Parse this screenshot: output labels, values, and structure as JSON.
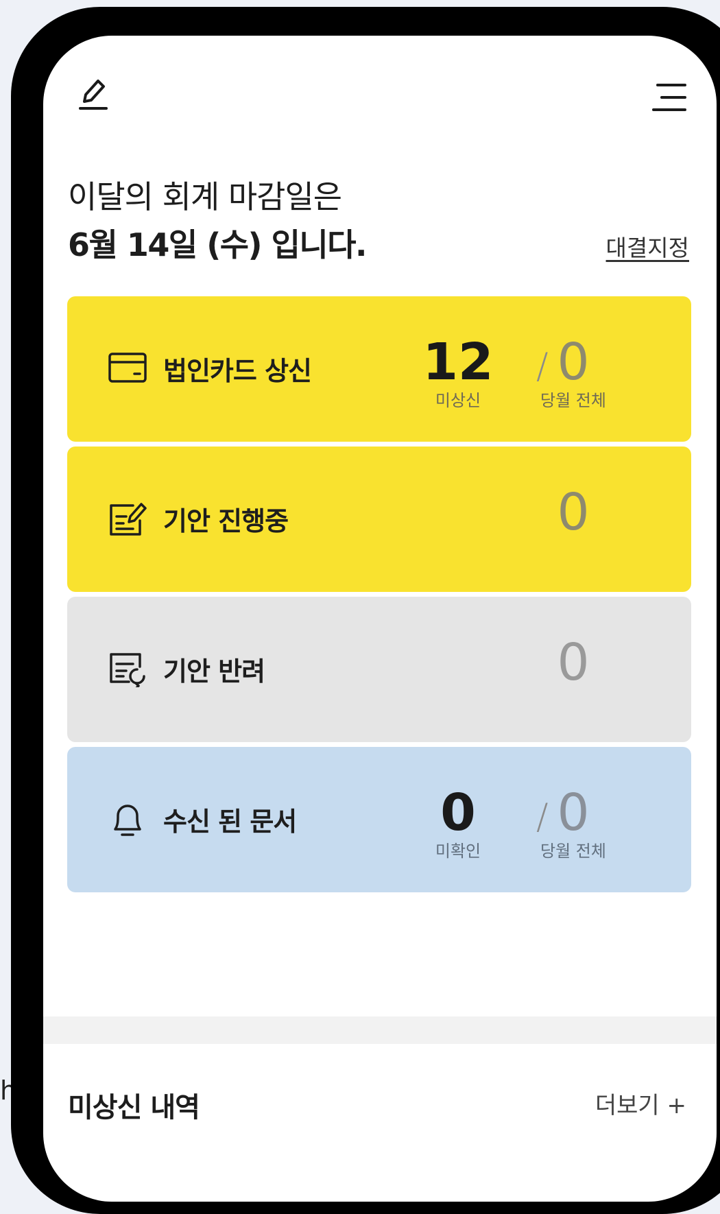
{
  "edge_text": "h",
  "header": {
    "icons": [
      "pencil-icon",
      "menu-icon"
    ]
  },
  "headline": {
    "line1": "이달의 회계 마감일은",
    "line2": "6월 14일 (수) 입니다."
  },
  "proxy_link": "대결지정",
  "cards": {
    "corporate_card": {
      "title": "법인카드 상신",
      "icon": "credit-card-icon",
      "stat_primary": {
        "value": "12",
        "caption": "미상신"
      },
      "stat_secondary": {
        "value": "0",
        "caption": "당월 전체"
      },
      "separator": "/",
      "color": "#f9e22f"
    },
    "draft_in_progress": {
      "title": "기안 진행중",
      "icon": "document-edit-icon",
      "value": "0",
      "color": "#f9e22f"
    },
    "draft_returned": {
      "title": "기안 반려",
      "icon": "document-return-icon",
      "value": "0",
      "color": "#e5e5e5"
    },
    "received_docs": {
      "title": "수신 된 문서",
      "icon": "bell-icon",
      "stat_primary": {
        "value": "0",
        "caption": "미확인"
      },
      "stat_secondary": {
        "value": "0",
        "caption": "당월 전체"
      },
      "separator": "/",
      "color": "#c6dbef"
    }
  },
  "section": {
    "title": "미상신 내역",
    "more_label": "더보기 +"
  }
}
